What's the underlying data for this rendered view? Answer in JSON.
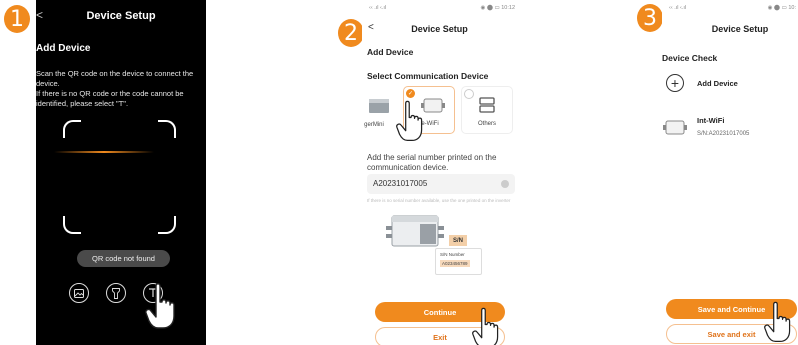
{
  "badges": [
    "1",
    "2",
    "3"
  ],
  "panel1": {
    "title": "Device Setup",
    "back": "<",
    "subtitle": "Add Device",
    "instructions": "Scan the QR code on the device to connect the device.\nIf there is no QR code or the code cannot be identified, please select \"T\".",
    "toast": "QR code not found",
    "buttons": [
      "image-icon",
      "flashlight-icon",
      "text-input-icon"
    ]
  },
  "panel2": {
    "status_left": "‹‹ .ıl ‹.ıl",
    "status_right": "◉ ⬤ ▭ 10:12",
    "back": "<",
    "title": "Device Setup",
    "subtitle": "Add Device",
    "section": "Select Communication Device",
    "devices": [
      {
        "label": "gerMini",
        "selected": false
      },
      {
        "label": "re-WiFi",
        "selected": true
      },
      {
        "label": "Others",
        "selected": false
      }
    ],
    "serial_prompt": "Add the serial number printed on the communication device.",
    "serial_value": "A20231017005",
    "hint": "If there is no serial number available, use the one printed on the inverter",
    "sn_label": "S/N",
    "sn_number_label": "S/N Number",
    "sn_number_value": "A023456789",
    "continue": "Continue",
    "exit": "Exit",
    "accent": "#f08a1e"
  },
  "panel3": {
    "status_left": "‹‹ .ıl ‹.ıl",
    "status_right": "◉ ⬤ ▭ 10:",
    "title": "Device Setup",
    "section": "Device Check",
    "add_device": "Add Device",
    "device_name": "Int-WiFi",
    "device_sn": "S/N:A20231017005",
    "save_continue": "Save and Continue",
    "save_exit": "Save and exit"
  }
}
